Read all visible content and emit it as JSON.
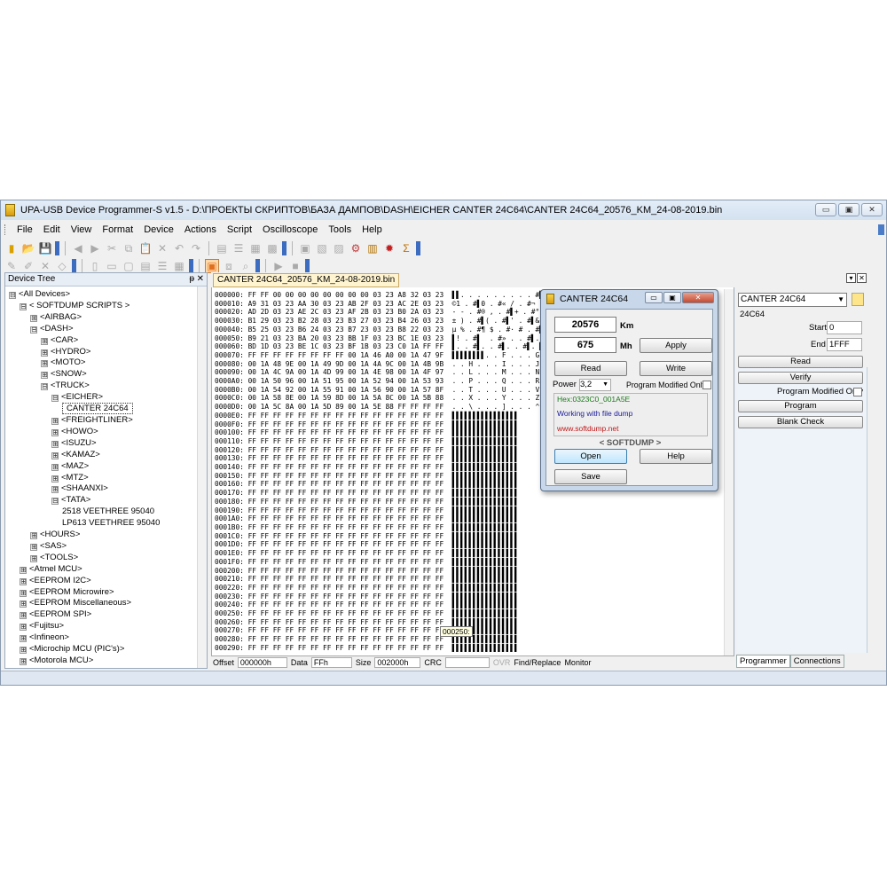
{
  "window": {
    "title": "UPA-USB Device Programmer-S v1.5 - D:\\ПРОЕКТЫ СКРИПТОВ\\БАЗА ДАМПОВ\\DASH\\EICHER CANTER 24C64\\CANTER 24C64_20576_KM_24-08-2019.bin",
    "minimize": "▭",
    "maximize": "▣",
    "close": "✕"
  },
  "menu": [
    "File",
    "Edit",
    "View",
    "Format",
    "Device",
    "Actions",
    "Script",
    "Oscilloscope",
    "Tools",
    "Help"
  ],
  "device_panel": {
    "title": "Device Tree",
    "pin": "ᵽ",
    "close": "✕",
    "tree": [
      {
        "label": "<All Devices>",
        "level": 0,
        "exp": "⊟"
      },
      {
        "label": "< SOFTDUMP SCRIPTS >",
        "level": 1,
        "exp": "⊟"
      },
      {
        "label": "<AIRBAG>",
        "level": 2,
        "exp": "⊞"
      },
      {
        "label": "<DASH>",
        "level": 2,
        "exp": "⊟"
      },
      {
        "label": "<CAR>",
        "level": 3,
        "exp": "⊞"
      },
      {
        "label": "<HYDRO>",
        "level": 3,
        "exp": "⊞"
      },
      {
        "label": "<MOTO>",
        "level": 3,
        "exp": "⊞"
      },
      {
        "label": "<SNOW>",
        "level": 3,
        "exp": "⊞"
      },
      {
        "label": "<TRUCK>",
        "level": 3,
        "exp": "⊟"
      },
      {
        "label": "<EICHER>",
        "level": 4,
        "exp": "⊟"
      },
      {
        "label": "CANTER 24C64",
        "level": 5,
        "exp": "",
        "selected": true
      },
      {
        "label": "<FREIGHTLINER>",
        "level": 4,
        "exp": "⊞"
      },
      {
        "label": "<HOWO>",
        "level": 4,
        "exp": "⊞"
      },
      {
        "label": "<ISUZU>",
        "level": 4,
        "exp": "⊞"
      },
      {
        "label": "<KAMAZ>",
        "level": 4,
        "exp": "⊞"
      },
      {
        "label": "<MAZ>",
        "level": 4,
        "exp": "⊞"
      },
      {
        "label": "<MTZ>",
        "level": 4,
        "exp": "⊞"
      },
      {
        "label": "<SHAANXI>",
        "level": 4,
        "exp": "⊞"
      },
      {
        "label": "<TATA>",
        "level": 4,
        "exp": "⊟"
      },
      {
        "label": "2518 VEETHREE 95040",
        "level": 5,
        "exp": ""
      },
      {
        "label": "LP613 VEETHREE 95040",
        "level": 5,
        "exp": ""
      },
      {
        "label": "<HOURS>",
        "level": 2,
        "exp": "⊞"
      },
      {
        "label": "<SAS>",
        "level": 2,
        "exp": "⊞"
      },
      {
        "label": "<TOOLS>",
        "level": 2,
        "exp": "⊞"
      },
      {
        "label": "<Atmel MCU>",
        "level": 1,
        "exp": "⊞"
      },
      {
        "label": "<EEPROM I2C>",
        "level": 1,
        "exp": "⊞"
      },
      {
        "label": "<EEPROM Microwire>",
        "level": 1,
        "exp": "⊞"
      },
      {
        "label": "<EEPROM Miscellaneous>",
        "level": 1,
        "exp": "⊞"
      },
      {
        "label": "<EEPROM SPI>",
        "level": 1,
        "exp": "⊞"
      },
      {
        "label": "<Fujitsu>",
        "level": 1,
        "exp": "⊞"
      },
      {
        "label": "<Infineon>",
        "level": 1,
        "exp": "⊞"
      },
      {
        "label": "<Microchip MCU (PIC's)>",
        "level": 1,
        "exp": "⊞"
      },
      {
        "label": "<Motorola MCU>",
        "level": 1,
        "exp": "⊞"
      }
    ]
  },
  "editor": {
    "tab_label": "CANTER 24C64_20576_KM_24-08-2019.bin",
    "lines": [
      {
        "addr": "000000:",
        "bytes": "FF FF 00 00 00 00 00 00 00 00 03 23 A8 32 03 23",
        "ascii": "▌▌. . . . . . . . . #▌2 . #"
      },
      {
        "addr": "000010:",
        "bytes": "A9 31 03 23 AA 30 03 23 AB 2F 03 23 AC 2E 03 23",
        "ascii": "©1 . #▌0 . #« / . #¬ . . #"
      },
      {
        "addr": "000020:",
        "bytes": "AD 2D 03 23 AE 2C 03 23 AF 2B 03 23 B0 2A 03 23",
        "ascii": "- - . #® , . #▌+ . #° * . #"
      },
      {
        "addr": "000030:",
        "bytes": "B1 29 03 23 B2 28 03 23 B3 27 03 23 B4 26 03 23",
        "ascii": "± ) . #▌( . #▌' . #▌& . #"
      },
      {
        "addr": "000040:",
        "bytes": "B5 25 03 23 B6 24 03 23 B7 23 03 23 B8 22 03 23",
        "ascii": "µ % . #¶ $ . #· # . #▌\" . #"
      },
      {
        "addr": "000050:",
        "bytes": "B9 21 03 23 BA 20 03 23 BB 1F 03 23 BC 1E 03 23",
        "ascii": "▌! . #▌  . #» . . #▌. . #"
      },
      {
        "addr": "000060:",
        "bytes": "BD 1D 03 23 BE 1C 03 23 BF 1B 03 23 C0 1A FF FF",
        "ascii": "▌. . #▌. . #▌. . #▌. ▌▌"
      },
      {
        "addr": "000070:",
        "bytes": "FF FF FF FF FF FF FF FF 00 1A 46 A0 00 1A 47 9F",
        "ascii": "▌▌▌▌▌▌▌▌. . F . . . G ."
      },
      {
        "addr": "000080:",
        "bytes": "00 1A 48 9E 00 1A 49 9D 00 1A 4A 9C 00 1A 4B 9B",
        "ascii": ". . H . . . I . . . J . . . K ."
      },
      {
        "addr": "000090:",
        "bytes": "00 1A 4C 9A 00 1A 4D 99 00 1A 4E 98 00 1A 4F 97",
        "ascii": ". . L . . . M . . . N . . . O ."
      },
      {
        "addr": "0000A0:",
        "bytes": "00 1A 50 96 00 1A 51 95 00 1A 52 94 00 1A 53 93",
        "ascii": ". . P . . . Q . . . R . . . S ."
      },
      {
        "addr": "0000B0:",
        "bytes": "00 1A 54 92 00 1A 55 91 00 1A 56 90 00 1A 57 8F",
        "ascii": ". . T . . . U . . . V . . . W ."
      },
      {
        "addr": "0000C0:",
        "bytes": "00 1A 58 8E 00 1A 59 8D 00 1A 5A 8C 00 1A 5B 88",
        "ascii": ". . X . . . Y . . . Z . . . [ ."
      },
      {
        "addr": "0000D0:",
        "bytes": "00 1A 5C 8A 00 1A 5D 89 00 1A 5E 88 FF FF FF FF",
        "ascii": ". . \\ . . . ] . . . ^ . ▌▌▌▌"
      },
      {
        "addr": "0000E0:",
        "bytes": "FF FF FF FF FF FF FF FF FF FF FF FF FF FF FF FF",
        "ascii": "▌▌▌▌▌▌▌▌▌▌▌▌▌▌▌▌"
      },
      {
        "addr": "0000F0:",
        "bytes": "FF FF FF FF FF FF FF FF FF FF FF FF FF FF FF FF",
        "ascii": "▌▌▌▌▌▌▌▌▌▌▌▌▌▌▌▌"
      },
      {
        "addr": "000100:",
        "bytes": "FF FF FF FF FF FF FF FF FF FF FF FF FF FF FF FF",
        "ascii": "▌▌▌▌▌▌▌▌▌▌▌▌▌▌▌▌"
      },
      {
        "addr": "000110:",
        "bytes": "FF FF FF FF FF FF FF FF FF FF FF FF FF FF FF FF",
        "ascii": "▌▌▌▌▌▌▌▌▌▌▌▌▌▌▌▌"
      },
      {
        "addr": "000120:",
        "bytes": "FF FF FF FF FF FF FF FF FF FF FF FF FF FF FF FF",
        "ascii": "▌▌▌▌▌▌▌▌▌▌▌▌▌▌▌▌"
      },
      {
        "addr": "000130:",
        "bytes": "FF FF FF FF FF FF FF FF FF FF FF FF FF FF FF FF",
        "ascii": "▌▌▌▌▌▌▌▌▌▌▌▌▌▌▌▌"
      },
      {
        "addr": "000140:",
        "bytes": "FF FF FF FF FF FF FF FF FF FF FF FF FF FF FF FF",
        "ascii": "▌▌▌▌▌▌▌▌▌▌▌▌▌▌▌▌"
      },
      {
        "addr": "000150:",
        "bytes": "FF FF FF FF FF FF FF FF FF FF FF FF FF FF FF FF",
        "ascii": "▌▌▌▌▌▌▌▌▌▌▌▌▌▌▌▌"
      },
      {
        "addr": "000160:",
        "bytes": "FF FF FF FF FF FF FF FF FF FF FF FF FF FF FF FF",
        "ascii": "▌▌▌▌▌▌▌▌▌▌▌▌▌▌▌▌"
      },
      {
        "addr": "000170:",
        "bytes": "FF FF FF FF FF FF FF FF FF FF FF FF FF FF FF FF",
        "ascii": "▌▌▌▌▌▌▌▌▌▌▌▌▌▌▌▌"
      },
      {
        "addr": "000180:",
        "bytes": "FF FF FF FF FF FF FF FF FF FF FF FF FF FF FF FF",
        "ascii": "▌▌▌▌▌▌▌▌▌▌▌▌▌▌▌▌"
      },
      {
        "addr": "000190:",
        "bytes": "FF FF FF FF FF FF FF FF FF FF FF FF FF FF FF FF",
        "ascii": "▌▌▌▌▌▌▌▌▌▌▌▌▌▌▌▌"
      },
      {
        "addr": "0001A0:",
        "bytes": "FF FF FF FF FF FF FF FF FF FF FF FF FF FF FF FF",
        "ascii": "▌▌▌▌▌▌▌▌▌▌▌▌▌▌▌▌"
      },
      {
        "addr": "0001B0:",
        "bytes": "FF FF FF FF FF FF FF FF FF FF FF FF FF FF FF FF",
        "ascii": "▌▌▌▌▌▌▌▌▌▌▌▌▌▌▌▌"
      },
      {
        "addr": "0001C0:",
        "bytes": "FF FF FF FF FF FF FF FF FF FF FF FF FF FF FF FF",
        "ascii": "▌▌▌▌▌▌▌▌▌▌▌▌▌▌▌▌"
      },
      {
        "addr": "0001D0:",
        "bytes": "FF FF FF FF FF FF FF FF FF FF FF FF FF FF FF FF",
        "ascii": "▌▌▌▌▌▌▌▌▌▌▌▌▌▌▌▌"
      },
      {
        "addr": "0001E0:",
        "bytes": "FF FF FF FF FF FF FF FF FF FF FF FF FF FF FF FF",
        "ascii": "▌▌▌▌▌▌▌▌▌▌▌▌▌▌▌▌"
      },
      {
        "addr": "0001F0:",
        "bytes": "FF FF FF FF FF FF FF FF FF FF FF FF FF FF FF FF",
        "ascii": "▌▌▌▌▌▌▌▌▌▌▌▌▌▌▌▌"
      },
      {
        "addr": "000200:",
        "bytes": "FF FF FF FF FF FF FF FF FF FF FF FF FF FF FF FF",
        "ascii": "▌▌▌▌▌▌▌▌▌▌▌▌▌▌▌▌"
      },
      {
        "addr": "000210:",
        "bytes": "FF FF FF FF FF FF FF FF FF FF FF FF FF FF FF FF",
        "ascii": "▌▌▌▌▌▌▌▌▌▌▌▌▌▌▌▌"
      },
      {
        "addr": "000220:",
        "bytes": "FF FF FF FF FF FF FF FF FF FF FF FF FF FF FF FF",
        "ascii": "▌▌▌▌▌▌▌▌▌▌▌▌▌▌▌▌"
      },
      {
        "addr": "000230:",
        "bytes": "FF FF FF FF FF FF FF FF FF FF FF FF FF FF FF FF",
        "ascii": "▌▌▌▌▌▌▌▌▌▌▌▌▌▌▌▌"
      },
      {
        "addr": "000240:",
        "bytes": "FF FF FF FF FF FF FF FF FF FF FF FF FF FF FF FF",
        "ascii": "▌▌▌▌▌▌▌▌▌▌▌▌▌▌▌▌"
      },
      {
        "addr": "000250:",
        "bytes": "FF FF FF FF FF FF FF FF FF FF FF FF FF FF FF FF",
        "ascii": "▌▌▌▌▌▌▌▌▌▌▌▌▌▌▌▌"
      },
      {
        "addr": "000260:",
        "bytes": "FF FF FF FF FF FF FF FF FF FF FF FF FF FF FF FF",
        "ascii": "▌▌▌▌▌▌▌▌▌▌▌▌▌▌▌▌"
      },
      {
        "addr": "000270:",
        "bytes": "FF FF FF FF FF FF FF FF FF FF FF FF FF FF FF FF",
        "ascii": "▌▌▌▌▌▌▌▌▌▌▌▌▌▌▌▌"
      },
      {
        "addr": "000280:",
        "bytes": "FF FF FF FF FF FF FF FF FF FF FF FF FF FF FF FF",
        "ascii": "▌▌▌▌▌▌▌▌▌▌▌▌▌▌▌▌"
      },
      {
        "addr": "000290:",
        "bytes": "FF FF FF FF FF FF FF FF FF FF FF FF FF FF FF FF",
        "ascii": "▌▌▌▌▌▌▌▌▌▌▌▌▌▌▌▌"
      }
    ],
    "tooltip": "000250:"
  },
  "statusbar": {
    "offset_label": "Offset",
    "offset_value": "000000h",
    "data_label": "Data",
    "data_value": "FFh",
    "size_label": "Size",
    "size_value": "002000h",
    "crc_label": "CRC",
    "crc_value": "",
    "ovr": "OVR",
    "find_replace": "Find/Replace",
    "monitor": "Monitor"
  },
  "right_panel": {
    "device_combo": "CANTER 24C64",
    "device_name": "24C64",
    "start_label": "Start",
    "start_value": "0",
    "end_label": "End",
    "end_value": "1FFF",
    "buttons": [
      "Read",
      "Verify"
    ],
    "prog_modified": "Program Modified Only",
    "buttons2": [
      "Program",
      "Blank Check"
    ],
    "tabs": [
      "Programmer",
      "Connections"
    ]
  },
  "dialog": {
    "title": "CANTER 24C64",
    "km_value": "20576",
    "km_unit": "Km",
    "mh_value": "675",
    "mh_unit": "Mh",
    "apply": "Apply",
    "read": "Read",
    "write": "Write",
    "power_label": "Power",
    "power_value": "3,2",
    "prog_modified": "Program Modified Only",
    "info_hex": "Hex:0323C0_001A5E",
    "info_status": "Working with file dump",
    "info_url": "www.softdump.net",
    "brand": "< SOFTDUMP >",
    "open": "Open",
    "help": "Help",
    "save": "Save"
  },
  "colors": {
    "accent": "#3b6cc0",
    "file_tab": "#fff4d0",
    "info_green": "#1a7a1a",
    "info_blue": "#1a1a9a",
    "info_red": "#c01818"
  }
}
